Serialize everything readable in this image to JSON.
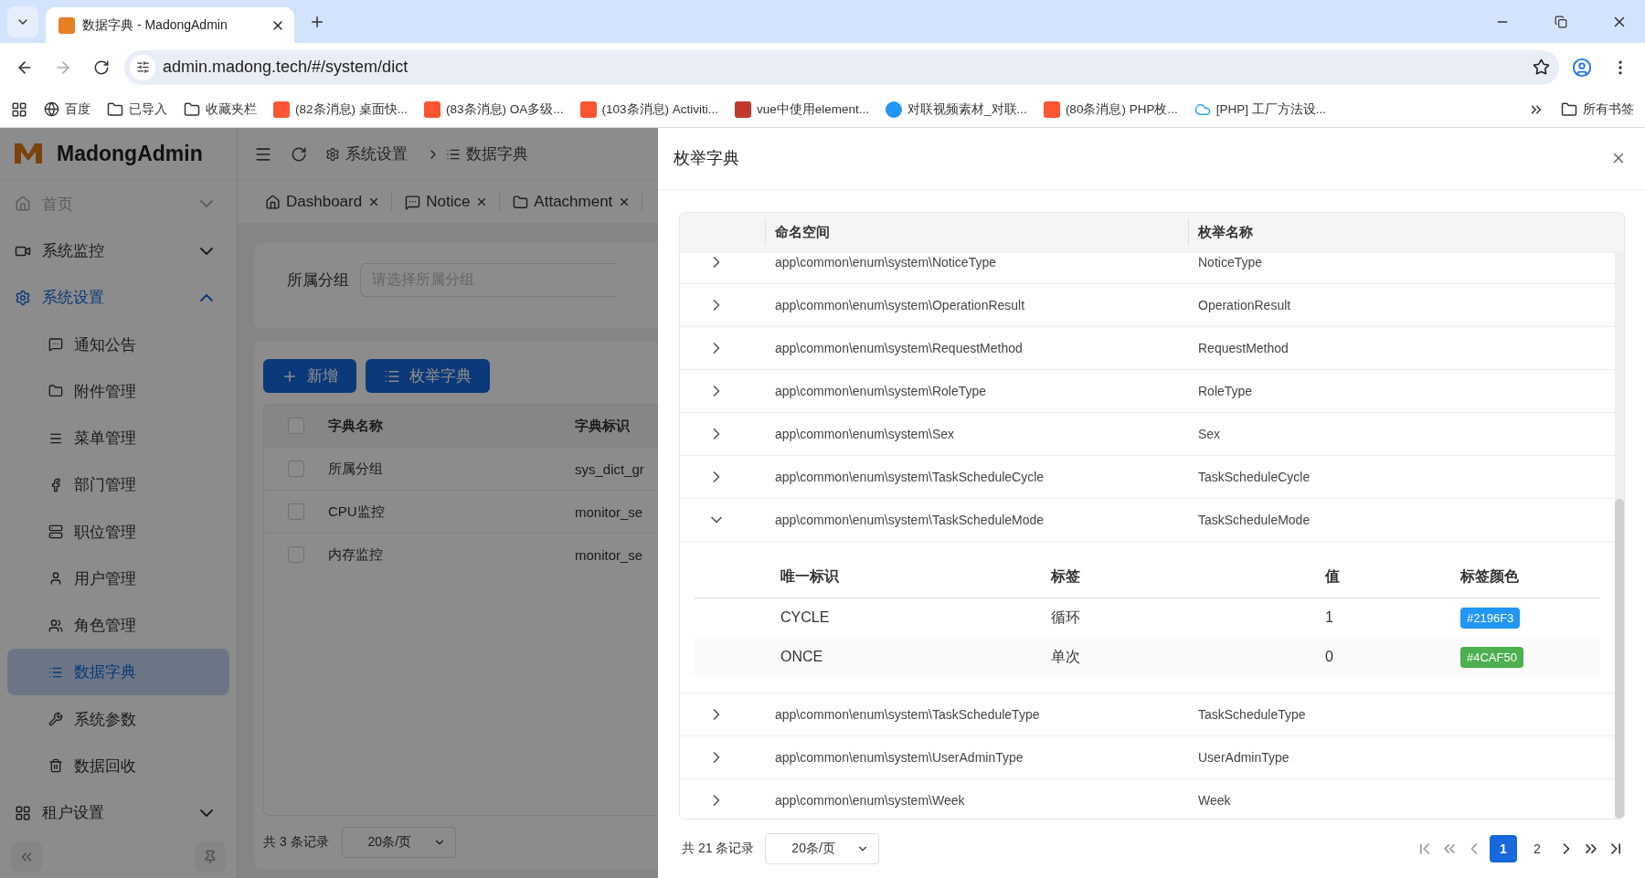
{
  "browser": {
    "tabs": [
      {
        "title": "数据字典 - MadongAdmin",
        "selected": true
      }
    ],
    "url": "admin.madong.tech/#/system/dict",
    "bookmarks": [
      {
        "label": "百度"
      },
      {
        "label": "已导入"
      },
      {
        "label": "收藏夹栏"
      },
      {
        "label": "(82条消息) 桌面快..."
      },
      {
        "label": "(83条消息) OA多级..."
      },
      {
        "label": "(103条消息) Activiti..."
      },
      {
        "label": "vue中使用element..."
      },
      {
        "label": "对联视频素材_对联..."
      },
      {
        "label": "(80条消息) PHP枚..."
      },
      {
        "label": "[PHP] 工厂方法设..."
      }
    ],
    "all_bookmarks": "所有书签"
  },
  "sidebar": {
    "logo": "MadongAdmin",
    "items": [
      {
        "label": "首页",
        "expanded": false,
        "disabled": true
      },
      {
        "label": "系统监控",
        "expanded": false,
        "disabled": false
      },
      {
        "label": "系统设置",
        "expanded": true,
        "disabled": false,
        "children": [
          {
            "label": "通知公告",
            "selected": false
          },
          {
            "label": "附件管理",
            "selected": false
          },
          {
            "label": "菜单管理",
            "selected": false
          },
          {
            "label": "部门管理",
            "selected": false
          },
          {
            "label": "职位管理",
            "selected": false
          },
          {
            "label": "用户管理",
            "selected": false
          },
          {
            "label": "角色管理",
            "selected": false
          },
          {
            "label": "数据字典",
            "selected": true
          },
          {
            "label": "系统参数",
            "selected": false
          },
          {
            "label": "数据回收",
            "selected": false
          }
        ]
      },
      {
        "label": "租户设置",
        "expanded": false,
        "disabled": false
      }
    ]
  },
  "header": {
    "breadcrumb": [
      "系统设置",
      "数据字典"
    ]
  },
  "page_tabs": [
    {
      "label": "Dashboard"
    },
    {
      "label": "Notice"
    },
    {
      "label": "Attachment"
    }
  ],
  "filter": {
    "label": "所属分组",
    "placeholder": "请选择所属分组"
  },
  "actions": [
    "新增",
    "枚举字典"
  ],
  "table": {
    "all_checked": false,
    "columns": [
      "字典名称",
      "字典标识"
    ],
    "rows": [
      {
        "name": "所属分组",
        "key": "sys_dict_gr",
        "checked": false
      },
      {
        "name": "CPU监控",
        "key": "monitor_se",
        "checked": false
      },
      {
        "name": "内存监控",
        "key": "monitor_se",
        "checked": false
      }
    ],
    "total": "共 3 条记录",
    "page_size": "20条/页"
  },
  "drawer": {
    "title": "枚举字典",
    "columns": [
      "命名空间",
      "枚举名称"
    ],
    "rows": [
      {
        "namespace": "app\\common\\enum\\system\\NoticeType",
        "name": "NoticeType",
        "expanded": false
      },
      {
        "namespace": "app\\common\\enum\\system\\OperationResult",
        "name": "OperationResult",
        "expanded": false
      },
      {
        "namespace": "app\\common\\enum\\system\\RequestMethod",
        "name": "RequestMethod",
        "expanded": false
      },
      {
        "namespace": "app\\common\\enum\\system\\RoleType",
        "name": "RoleType",
        "expanded": false
      },
      {
        "namespace": "app\\common\\enum\\system\\Sex",
        "name": "Sex",
        "expanded": false
      },
      {
        "namespace": "app\\common\\enum\\system\\TaskScheduleCycle",
        "name": "TaskScheduleCycle",
        "expanded": false
      },
      {
        "namespace": "app\\common\\enum\\system\\TaskScheduleMode",
        "name": "TaskScheduleMode",
        "expanded": true,
        "detail": {
          "columns": [
            "唯一标识",
            "标签",
            "值",
            "标签颜色"
          ],
          "items": [
            {
              "key": "CYCLE",
              "label": "循环",
              "value": "1",
              "tag": "#2196F3",
              "color": "#2196f3"
            },
            {
              "key": "ONCE",
              "label": "单次",
              "value": "0",
              "tag": "#4CAF50",
              "color": "#4caf50"
            }
          ]
        }
      },
      {
        "namespace": "app\\common\\enum\\system\\TaskScheduleType",
        "name": "TaskScheduleType",
        "expanded": false
      },
      {
        "namespace": "app\\common\\enum\\system\\UserAdminType",
        "name": "UserAdminType",
        "expanded": false
      },
      {
        "namespace": "app\\common\\enum\\system\\Week",
        "name": "Week",
        "expanded": false
      }
    ],
    "total": "共 21 条记录",
    "page_size": "20条/页",
    "pages": [
      {
        "label": "1",
        "selected": true
      },
      {
        "label": "2",
        "selected": false
      }
    ]
  }
}
